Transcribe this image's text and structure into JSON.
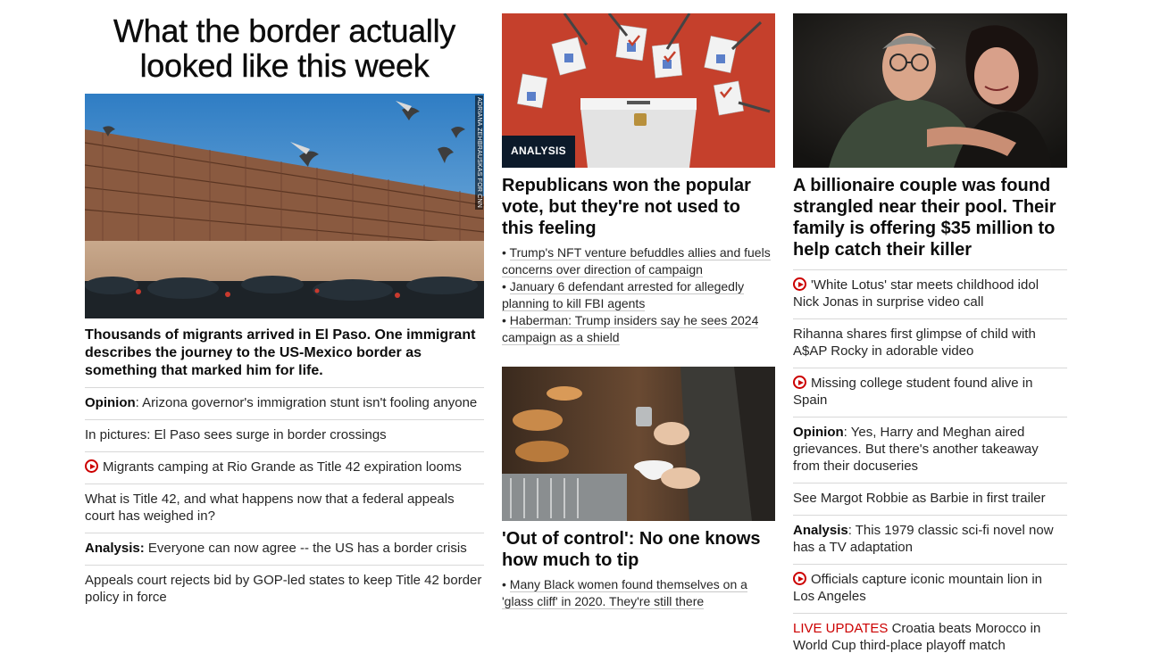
{
  "left": {
    "headline": "What the border actually looked like this week",
    "photo_credit": "ADRIANA ZEHBRAUSKAS FOR CNN",
    "caption": "Thousands of migrants arrived in El Paso. One immigrant describes the journey to the US-Mexico border as something that marked him for life.",
    "items": [
      {
        "prefix": "Opinion",
        "text": ": Arizona governor's immigration stunt isn't fooling anyone"
      },
      {
        "text": "In pictures: El Paso sees surge in border crossings"
      },
      {
        "text": "Migrants camping at Rio Grande as Title 42 expiration looms",
        "video": true
      },
      {
        "text": "What is Title 42, and what happens now that a federal appeals court has weighed in?"
      },
      {
        "prefix": "Analysis:",
        "text": " Everyone can now agree -- the US has a border crisis"
      },
      {
        "text": "Appeals court rejects bid by GOP-led states to keep Title 42 border policy in force"
      }
    ]
  },
  "middle": {
    "card1": {
      "badge": "ANALYSIS",
      "title": "Republicans won the popular vote, but they're not used to this feeling",
      "bullets": [
        "Trump's NFT venture befuddles allies and fuels concerns over direction of campaign",
        "January 6 defendant arrested for allegedly planning to kill FBI agents",
        "Haberman: Trump insiders say he sees 2024 campaign as a shield"
      ]
    },
    "card2": {
      "title": "'Out of control': No one knows how much to tip",
      "bullets": [
        "Many Black women found themselves on a 'glass cliff' in 2020. They're still there"
      ]
    },
    "bullet_char": "•"
  },
  "right": {
    "title": "A billionaire couple was found strangled near their pool. Their family is offering $35 million to help catch their killer",
    "items": [
      {
        "text": "'White Lotus' star meets childhood idol Nick Jonas in surprise video call",
        "video": true
      },
      {
        "text": "Rihanna shares first glimpse of child with A$AP Rocky in adorable video"
      },
      {
        "text": "Missing college student found alive in Spain",
        "video": true
      },
      {
        "prefix": "Opinion",
        "text": ": Yes, Harry and Meghan aired grievances. But there's another takeaway from their docuseries"
      },
      {
        "text": "See Margot Robbie as Barbie in first trailer"
      },
      {
        "prefix": "Analysis",
        "text": ": This 1979 classic sci-fi novel now has a TV adaptation"
      },
      {
        "text": "Officials capture iconic mountain lion in Los Angeles",
        "video": true
      },
      {
        "live": "LIVE UPDATES",
        "text": " Croatia beats Morocco in World Cup third-place playoff match"
      }
    ]
  },
  "colors": {
    "accent_red": "#cc0000",
    "badge_bg": "#0c1a2a",
    "divider": "#d8d8d8"
  }
}
